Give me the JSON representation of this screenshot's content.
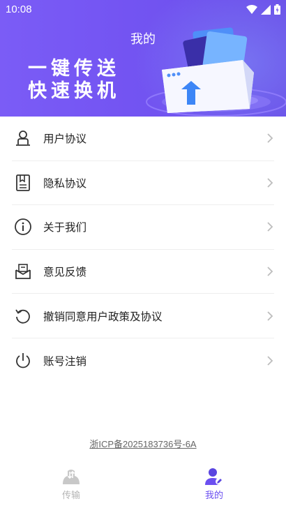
{
  "status_bar": {
    "time": "10:08"
  },
  "header": {
    "title": "我的",
    "slogan_line1": "一键传送",
    "slogan_line2": "快速换机"
  },
  "menu": {
    "items": [
      {
        "label": "用户协议",
        "icon": "user-agreement-icon"
      },
      {
        "label": "隐私协议",
        "icon": "privacy-document-icon"
      },
      {
        "label": "关于我们",
        "icon": "info-icon"
      },
      {
        "label": "意见反馈",
        "icon": "feedback-mail-icon"
      },
      {
        "label": "撤销同意用户政策及协议",
        "icon": "revoke-refresh-icon"
      },
      {
        "label": "账号注销",
        "icon": "power-icon"
      }
    ]
  },
  "footer": {
    "icp": "浙ICP备2025183736号-6A"
  },
  "tabbar": {
    "tabs": [
      {
        "label": "传输",
        "icon": "transfer-icon",
        "active": false
      },
      {
        "label": "我的",
        "icon": "profile-icon",
        "active": true
      }
    ]
  },
  "colors": {
    "accent": "#6b4ff0",
    "banner": "#7354f2",
    "inactive": "#b5b5b5"
  }
}
